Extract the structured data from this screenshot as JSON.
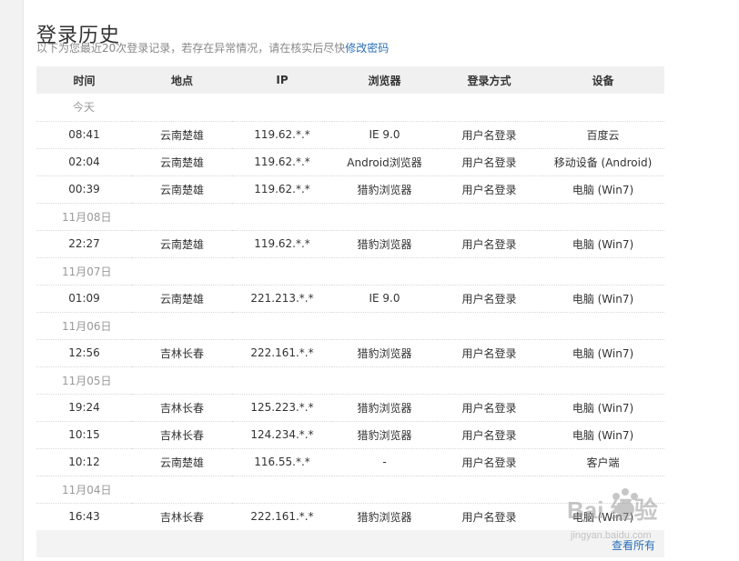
{
  "page": {
    "title": "登录历史",
    "subtitle": "以下为您最近20次登录记录，若存在异常情况，请在核实后尽快",
    "subtitle_link": "修改密码"
  },
  "table": {
    "headers": [
      "时间",
      "地点",
      "IP",
      "浏览器",
      "登录方式",
      "设备"
    ],
    "groups": [
      {
        "date": "今天",
        "rows": [
          [
            "08:41",
            "云南楚雄",
            "119.62.*.*",
            "IE 9.0",
            "用户名登录",
            "百度云"
          ],
          [
            "02:04",
            "云南楚雄",
            "119.62.*.*",
            "Android浏览器",
            "用户名登录",
            "移动设备 (Android)"
          ],
          [
            "00:39",
            "云南楚雄",
            "119.62.*.*",
            "猎豹浏览器",
            "用户名登录",
            "电脑 (Win7)"
          ]
        ]
      },
      {
        "date": "11月08日",
        "rows": [
          [
            "22:27",
            "云南楚雄",
            "119.62.*.*",
            "猎豹浏览器",
            "用户名登录",
            "电脑 (Win7)"
          ]
        ]
      },
      {
        "date": "11月07日",
        "rows": [
          [
            "01:09",
            "云南楚雄",
            "221.213.*.*",
            "IE 9.0",
            "用户名登录",
            "电脑 (Win7)"
          ]
        ]
      },
      {
        "date": "11月06日",
        "rows": [
          [
            "12:56",
            "吉林长春",
            "222.161.*.*",
            "猎豹浏览器",
            "用户名登录",
            "电脑 (Win7)"
          ]
        ]
      },
      {
        "date": "11月05日",
        "rows": [
          [
            "19:24",
            "吉林长春",
            "125.223.*.*",
            "猎豹浏览器",
            "用户名登录",
            "电脑 (Win7)"
          ],
          [
            "10:15",
            "吉林长春",
            "124.234.*.*",
            "猎豹浏览器",
            "用户名登录",
            "电脑 (Win7)"
          ],
          [
            "10:12",
            "云南楚雄",
            "116.55.*.*",
            "-",
            "用户名登录",
            "客户端"
          ]
        ]
      },
      {
        "date": "11月04日",
        "rows": [
          [
            "16:43",
            "吉林长春",
            "222.161.*.*",
            "猎豹浏览器",
            "用户名登录",
            "电脑 (Win7)"
          ]
        ]
      }
    ]
  },
  "footer": {
    "view_all": "查看所有"
  },
  "watermark": {
    "text": "Bai 经验",
    "subtext": "jingyan.baidu.com"
  }
}
